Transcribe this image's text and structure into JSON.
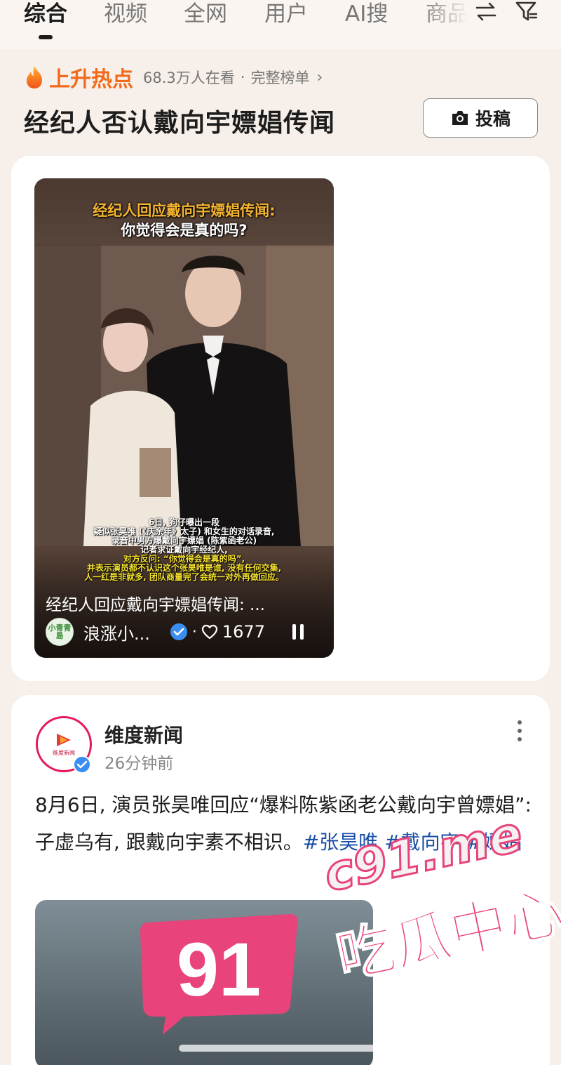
{
  "tabs": [
    {
      "label": "综合",
      "active": true
    },
    {
      "label": "视频"
    },
    {
      "label": "全网"
    },
    {
      "label": "用户"
    },
    {
      "label": "AI搜"
    },
    {
      "label": "商品"
    }
  ],
  "trend": {
    "label": "上升热点",
    "viewers": "68.3万人在看",
    "separator": "·",
    "full_list": "完整榜单",
    "chevron": "›"
  },
  "topic_title": "经纪人否认戴向宇嫖娼传闻",
  "submit_label": "投稿",
  "video_card": {
    "headline": "经纪人回应戴向宇嫖娼传闻:",
    "subheadline": "你觉得会是真的吗?",
    "subtitles": [
      "6日, 狗仔曝出一段",
      "疑似张昊唯 (《庆余年》太子) 和女生的对话录音,",
      "录音中男方爆戴向宇嫖娼 (陈紫函老公)",
      "记者求证戴向宇经纪人,",
      "对方反问: “你觉得会是真的吗”,",
      "并表示演员都不认识这个张昊唯是谁, 没有任何交集,",
      "人一红是非就多, 团队商量完了会统一对外再做回应。"
    ],
    "caption": "经纪人回应戴向宇嫖娼传闻: ...",
    "author_logo_text": "小青青島",
    "author": "浪涨小...",
    "dot": "·",
    "likes": "1677"
  },
  "post": {
    "source": "维度新闻",
    "avatar_text": "维度新闻",
    "time": "26分钟前",
    "text": "8月6日, 演员张昊唯回应“爆料陈紫函老公戴向宇曾嫖娼”: 子虚乌有, 跟戴向宇素不相识。",
    "hashtags": [
      "#张昊唯",
      "#戴向宇",
      "#嫖娼"
    ]
  },
  "watermark": {
    "number": "91",
    "domain": "c91.me",
    "slogan": "吃瓜中心"
  },
  "colors": {
    "accent_orange": "#f26a1b",
    "hashtag_blue": "#1a4fa8",
    "watermark_pink": "#e8437a",
    "background": "#f7efe9"
  }
}
